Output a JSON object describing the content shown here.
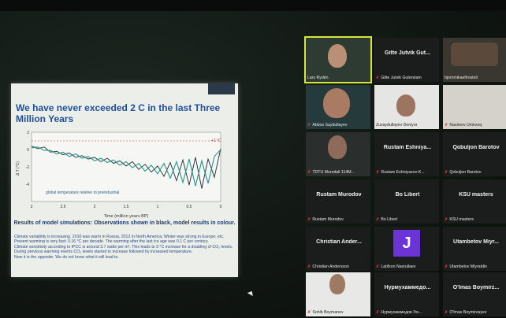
{
  "slide": {
    "presenter_name": "Lars Rydén",
    "title": "We have never exceeded 2 C in the last Three Million Years",
    "caption": "Results of model simulations: Observations shown in black, model results in colour.",
    "notes": [
      "Climate variability is increasing. 2010 was warm in Russia, 2012 in North America; Winter was strong in Europe; etc.",
      "Present warming is very fast: 0.16 °C per decade. The warming after the last ice age was 0.1 C per century.",
      "Climate sensitivity according to IPCC is around 3.7 watts per m². This leads to 3 °C increase for a doubling of CO₂ levels.",
      "During previous warming events CO₂ levels started to increase followed by increased temperature.",
      "Now it is the opposite. We do not know what it will lead to."
    ]
  },
  "chart_data": {
    "type": "line",
    "title": "",
    "xlabel": "Time (million years BP)",
    "ylabel": "Δ T (°C)",
    "xlim": [
      3,
      0
    ],
    "ylim": [
      -6,
      2
    ],
    "x_ticks": [
      "3",
      "2.5",
      "2",
      "1.5",
      "1",
      "0.5",
      "0"
    ],
    "y_ticks": [
      "2",
      "0",
      "-2",
      "-4"
    ],
    "annotation": "global temperature relative to preindustrial",
    "marker_label": "+1 °C",
    "series": [
      {
        "color": "#1f2a36",
        "x": [
          3,
          2.9,
          2.8,
          2.7,
          2.6,
          2.5,
          2.4,
          2.3,
          2.2,
          2.1,
          2.0,
          1.9,
          1.8,
          1.7,
          1.6,
          1.5,
          1.4,
          1.3,
          1.2,
          1.1,
          1.0,
          0.9,
          0.8,
          0.7,
          0.6,
          0.5,
          0.4,
          0.3,
          0.2,
          0.1,
          0
        ],
        "values": [
          0.4,
          0.1,
          0.3,
          -0.3,
          -0.2,
          -0.6,
          -0.4,
          -0.9,
          -0.7,
          -1.1,
          -0.9,
          -1.4,
          -1.0,
          -1.6,
          -1.3,
          -1.9,
          -1.4,
          -2.3,
          -1.7,
          -2.6,
          -1.9,
          -3.1,
          -1.5,
          -3.6,
          -1.2,
          -4.1,
          -0.9,
          -4.5,
          -1.1,
          -3.2,
          0.1
        ]
      },
      {
        "color": "#1e9a8a",
        "x": [
          3,
          2.9,
          2.8,
          2.7,
          2.6,
          2.5,
          2.4,
          2.3,
          2.2,
          2.1,
          2.0,
          1.9,
          1.8,
          1.7,
          1.6,
          1.5,
          1.4,
          1.3,
          1.2,
          1.1,
          1.0,
          0.9,
          0.8,
          0.7,
          0.6,
          0.5,
          0.4,
          0.3,
          0.2,
          0.1,
          0
        ],
        "values": [
          0.2,
          0.3,
          -0.1,
          -0.1,
          -0.5,
          -0.3,
          -0.8,
          -0.5,
          -1.0,
          -0.8,
          -1.3,
          -1.0,
          -1.5,
          -1.2,
          -1.8,
          -1.4,
          -2.1,
          -1.6,
          -2.5,
          -1.8,
          -2.8,
          -1.6,
          -3.3,
          -1.4,
          -3.8,
          -1.1,
          -4.2,
          -1.3,
          -3.9,
          -0.8,
          0.0
        ]
      }
    ]
  },
  "participants": [
    {
      "display": "",
      "label": "Lars Rydén",
      "mic_muted": false,
      "active": true
    },
    {
      "display": "Gitte Jutvik Gut...",
      "label": "Gitte Jutvik Guterstam",
      "mic_muted": true
    },
    {
      "display": "",
      "label": "bjornmikaelfrostell",
      "mic_muted": false
    },
    {
      "display": "",
      "label": "Abbos Saydullayev",
      "mic_muted": true
    },
    {
      "display": "",
      "label": "Zuvaydullayev Doniyor",
      "mic_muted": false
    },
    {
      "display": "",
      "label": "Nasimov Umirzoq",
      "mic_muted": true
    },
    {
      "display": "",
      "label": "TDTU Murodali 114M...",
      "mic_muted": true
    },
    {
      "display": "Rustam Eshniya...",
      "label": "Rustam Eshniyazov-K...",
      "mic_muted": true
    },
    {
      "display": "Qobuljon Barotov",
      "label": "Qobuljon Barotov",
      "mic_muted": true
    },
    {
      "display": "Rustam Murodov",
      "label": "Rustam Murodov",
      "mic_muted": true
    },
    {
      "display": "Bo Libert",
      "label": "Bo Libert",
      "mic_muted": true
    },
    {
      "display": "KSU masters",
      "label": "KSU masters",
      "mic_muted": true
    },
    {
      "display": "Christian Ander...",
      "label": "Christian Andersson",
      "mic_muted": true
    },
    {
      "display": "J",
      "label": "Latifxon Nasrullaev",
      "mic_muted": true
    },
    {
      "display": "Utambetov Miyr...",
      "label": "Utambetov Miyratdin",
      "mic_muted": true
    },
    {
      "display": "",
      "label": "Sohib Boymanov",
      "mic_muted": true
    },
    {
      "display": "Нурмухаммедо...",
      "label": "Нурмухаммедов Ум...",
      "mic_muted": true
    },
    {
      "display": "O'lmas Boymirz...",
      "label": "O'lmas Boymirzayev",
      "mic_muted": true
    }
  ],
  "colors": {
    "slide_title": "#1e4f9c",
    "active_speaker": "#d8e63a",
    "muted_mic": "#e23b3b",
    "avatar_j": "#6a34d6"
  }
}
